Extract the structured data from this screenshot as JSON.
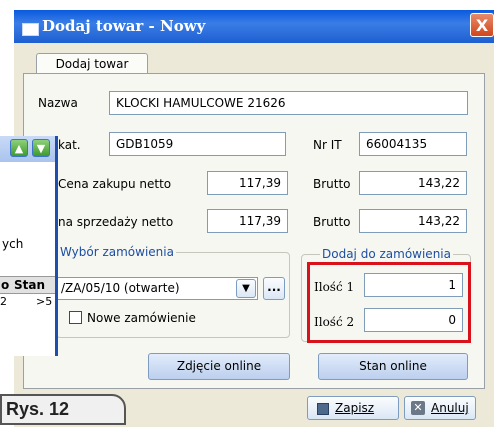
{
  "window": {
    "title": "Dodaj towar - Nowy",
    "close_glyph": "X"
  },
  "tab": {
    "label": "Dodaj towar"
  },
  "form": {
    "nazwa_label": "Nazwa",
    "nazwa_value": "KLOCKI HAMULCOWE    21626",
    "kat_label": "kat.",
    "kat_value": "GDB1059",
    "nrit_label": "Nr IT",
    "nrit_value": "66004135",
    "cena_zakupu_label": "Cena zakupu netto",
    "cena_zakupu_value": "117,39",
    "brutto1_label": "Brutto",
    "brutto1_value": "143,22",
    "cena_sprzedazy_label": "na sprzedaży netto",
    "cena_sprzedazy_value": "117,39",
    "brutto2_label": "Brutto",
    "brutto2_value": "143,22"
  },
  "order_group": {
    "legend": "Wybór zamówienia",
    "selected": "/ZA/05/10 (otwarte)",
    "ellipsis": "...",
    "new_order_label": "Nowe zamówienie"
  },
  "add_group": {
    "legend": "Dodaj do zamówienia",
    "ilosc1_label": "Ilość 1",
    "ilosc1_value": "1",
    "ilosc2_label": "Ilość 2",
    "ilosc2_value": "0"
  },
  "buttons": {
    "zdjecie": "Zdjęcie online",
    "stan": "Stan online",
    "zapisz": "Zapisz",
    "anuluj": "Anuluj"
  },
  "overlay_window": {
    "partial_text": "ych",
    "col_o": "o",
    "col_stan": "Stan",
    "row_a": "2",
    "row_b": ">5"
  },
  "caption": "Rys. 12",
  "colors": {
    "title_bar": "#1e5fd0",
    "highlight_border": "#d8111a",
    "legend_text": "#1c4ea2"
  }
}
